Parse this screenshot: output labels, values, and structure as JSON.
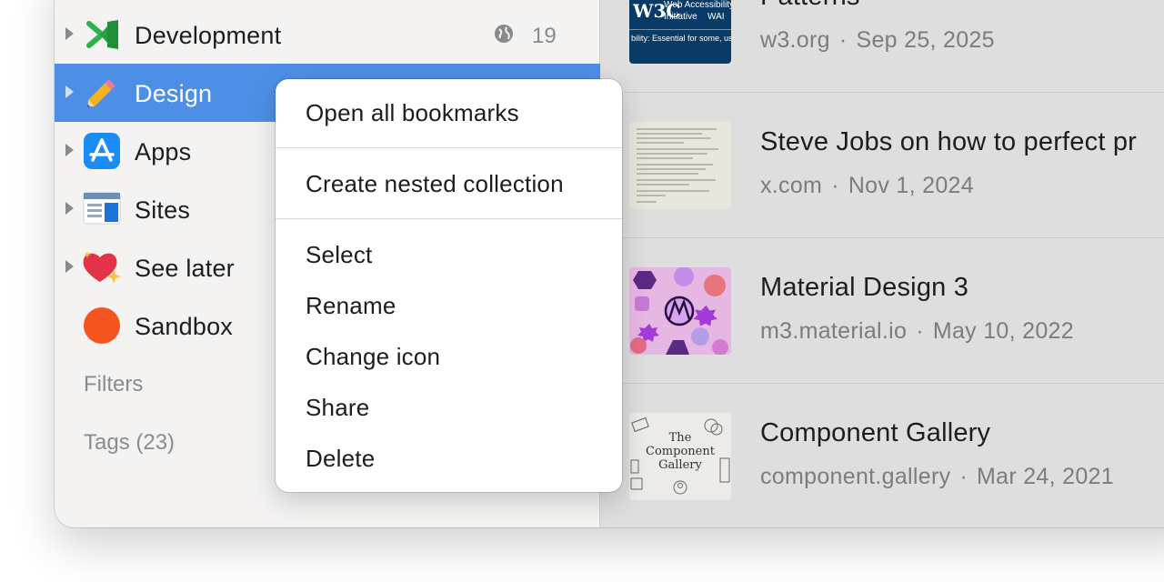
{
  "sidebar": {
    "collections": [
      {
        "label": "Development",
        "icon": "vscode-icon",
        "count": "19",
        "shared": true
      },
      {
        "label": "Design",
        "icon": "pencil-icon",
        "selected": true
      },
      {
        "label": "Apps",
        "icon": "app-store-icon"
      },
      {
        "label": "Sites",
        "icon": "browser-window-icon"
      },
      {
        "label": "See later",
        "icon": "sparkling-heart-icon"
      },
      {
        "label": "Sandbox",
        "icon": "orange-circle-icon"
      }
    ],
    "filters_label": "Filters",
    "tags_label": "Tags (23)"
  },
  "bookmarks": [
    {
      "title": "Patterns",
      "domain": "w3.org",
      "date": "Sep 25, 2025",
      "thumb_text": [
        "W3C",
        "Web Accessibility",
        "Initiative",
        "WAI",
        "bility: Essential for some, useful"
      ]
    },
    {
      "title": "Steve Jobs on how to perfect pr",
      "domain": "x.com",
      "date": "Nov 1, 2024"
    },
    {
      "title": "Material Design 3",
      "domain": "m3.material.io",
      "date": "May 10, 2022"
    },
    {
      "title": "Component Gallery",
      "domain": "component.gallery",
      "date": "Mar 24, 2021",
      "thumb_text": [
        "The",
        "Component",
        "Gallery"
      ]
    }
  ],
  "context_menu": {
    "group1": [
      "Open all bookmarks"
    ],
    "group2": [
      "Create nested collection"
    ],
    "group3": [
      "Select",
      "Rename",
      "Change icon",
      "Share",
      "Delete"
    ]
  },
  "colors": {
    "selection": "#4d8fe6",
    "sidebar_bg": "#f4f3f2",
    "main_bg": "#dedede"
  }
}
